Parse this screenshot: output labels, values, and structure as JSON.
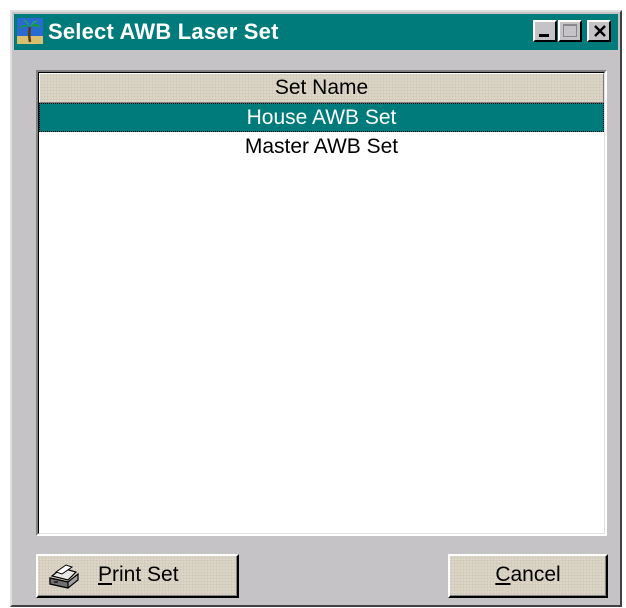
{
  "window": {
    "title": "Select AWB Laser Set",
    "controls": {
      "minimize": "minimize",
      "maximize": "maximize",
      "close": "close"
    },
    "icons": {
      "app": "palm-tree-app-icon",
      "print": "printer-icon"
    }
  },
  "list": {
    "column_header": "Set Name",
    "items": [
      {
        "label": "House AWB Set",
        "selected": true
      },
      {
        "label": "Master AWB Set",
        "selected": false
      }
    ]
  },
  "buttons": {
    "print": {
      "mnemonic": "P",
      "rest": "rint Set"
    },
    "cancel": {
      "mnemonic": "C",
      "rest": "ancel"
    }
  },
  "colors": {
    "titlebar": "#007b7b",
    "selection": "#007b7b",
    "face": "#c6c3c6"
  }
}
